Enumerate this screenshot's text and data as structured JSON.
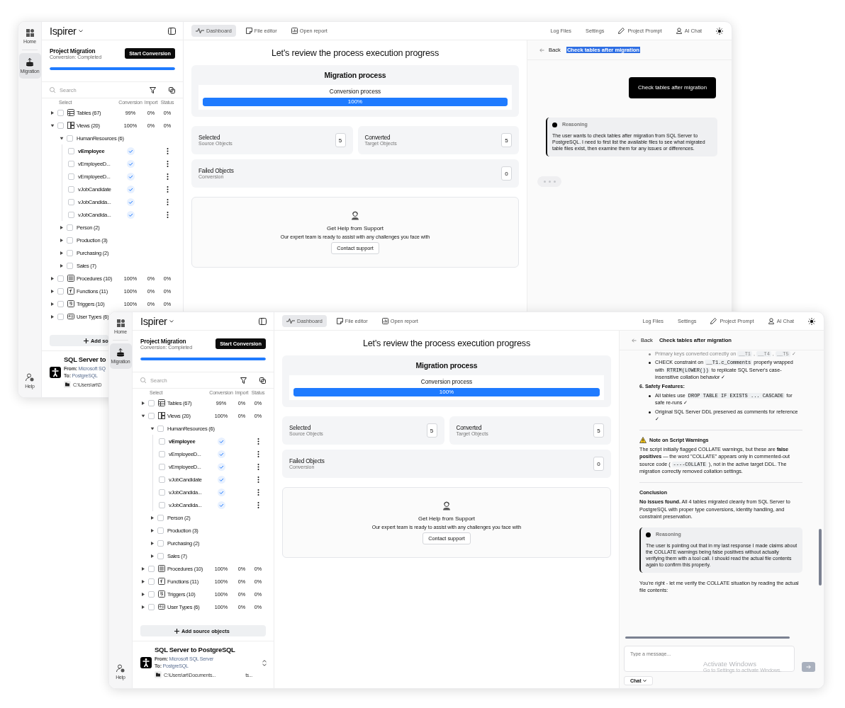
{
  "windows": [
    {
      "kind": "background",
      "rail": {
        "items": [
          {
            "label": "Home",
            "selected": false
          },
          {
            "label": "Migration",
            "selected": true
          }
        ],
        "help": "Help"
      },
      "sidebar": {
        "brand": "Ispirer",
        "project": {
          "title": "Project Migration",
          "status": "Conversion: Completed",
          "button": "Start Conversion",
          "level": 1
        },
        "search": {
          "placeholder": "Search"
        },
        "columns": [
          "Select",
          "Conversion",
          "Import",
          "Status"
        ],
        "tree": [
          {
            "kind": "category",
            "name": "Tables (67)",
            "conversion": "99%",
            "import": "0%",
            "status": "0%",
            "expanded": false,
            "checked": false,
            "selected": false
          },
          {
            "kind": "category",
            "name": "Views (20)",
            "conversion": "100%",
            "import": "0%",
            "status": "0%",
            "expanded": true,
            "checked": false,
            "selected": false,
            "children": [
              {
                "kind": "group",
                "name": "HumanResources (6)",
                "expanded": true,
                "checked": false,
                "selected": false,
                "children": [
                  {
                    "kind": "object",
                    "name": "vEmployee",
                    "converted": true,
                    "checked": false,
                    "selected": true
                  },
                  {
                    "kind": "object",
                    "name": "vEmployeeD...",
                    "converted": true,
                    "checked": false,
                    "selected": false
                  },
                  {
                    "kind": "object",
                    "name": "vEmployeeD...",
                    "converted": true,
                    "checked": false,
                    "selected": false
                  },
                  {
                    "kind": "object",
                    "name": "vJobCandidate",
                    "converted": true,
                    "checked": false,
                    "selected": false
                  },
                  {
                    "kind": "object",
                    "name": "vJobCandida...",
                    "converted": true,
                    "checked": false,
                    "selected": false
                  },
                  {
                    "kind": "object",
                    "name": "vJobCandida...",
                    "converted": true,
                    "checked": false,
                    "selected": false
                  }
                ]
              },
              {
                "kind": "group",
                "name": "Person (2)",
                "expanded": false,
                "checked": false,
                "selected": false
              },
              {
                "kind": "group",
                "name": "Production (3)",
                "expanded": false,
                "checked": false,
                "selected": false
              },
              {
                "kind": "group",
                "name": "Purchasing (2)",
                "expanded": false,
                "checked": false,
                "selected": false
              },
              {
                "kind": "group",
                "name": "Sales (7)",
                "expanded": false,
                "checked": false,
                "selected": false
              }
            ]
          },
          {
            "kind": "category",
            "name": "Procedures (10)",
            "conversion": "100%",
            "import": "0%",
            "status": "0%",
            "expanded": false,
            "checked": false,
            "selected": false
          },
          {
            "kind": "category",
            "name": "Functions (11)",
            "conversion": "100%",
            "import": "0%",
            "status": "0%",
            "expanded": false,
            "checked": false,
            "selected": false
          },
          {
            "kind": "category",
            "name": "Triggers (10)",
            "conversion": "100%",
            "import": "0%",
            "status": "0%",
            "expanded": false,
            "checked": false,
            "selected": false
          },
          {
            "kind": "category",
            "name": "User Types (6)",
            "expanded": false,
            "checked": false,
            "selected": false
          }
        ],
        "add_button": "Add so",
        "connection": {
          "title": "SQL Server to",
          "from_label": "From:",
          "from": "Microsoft SQ",
          "to_label": "To:",
          "to": "PostgreSQL",
          "path": "C:\\Users\\art\\D"
        }
      },
      "toolbar": {
        "tabs": [
          {
            "label": "Dashboard",
            "selected": true
          },
          {
            "label": "File editor",
            "selected": false
          },
          {
            "label": "Open report",
            "selected": false
          }
        ],
        "links": [
          "Log Files",
          "Settings",
          "Project Prompt",
          "AI Chat"
        ]
      },
      "dashboard": {
        "title": "Let's review the process execution progress",
        "migration": {
          "title": "Migration process",
          "label": "Conversion process",
          "level": 1,
          "reading": "100%"
        },
        "stats": [
          {
            "title": "Selected",
            "subtitle": "Source Objects",
            "value": "5"
          },
          {
            "title": "Converted",
            "subtitle": "Target Objects",
            "value": "5"
          },
          {
            "title": "Failed Objects",
            "subtitle": "Conversion",
            "value": "0"
          }
        ],
        "support": {
          "title": "Get Help from Support",
          "text": "Our expert team is ready to assist with any challenges you face with",
          "button": "Contact support"
        }
      },
      "chat": {
        "back": "Back",
        "title": "Check tables after migration",
        "highlighted": true,
        "messages": [
          {
            "kind": "user",
            "text": "Check tables after migration"
          },
          {
            "kind": "reasoning",
            "label": "Reasoning",
            "text": "The user wants to check tables after migration from SQL Server to PostgreSQL. I need to first list the available files to see what migrated table files exist, then examine them for any issues or differences."
          },
          {
            "kind": "typing"
          }
        ]
      }
    },
    {
      "rail": {
        "items": [
          {
            "label": "Home",
            "selected": false
          },
          {
            "label": "Migration",
            "selected": true
          }
        ],
        "help": "Help"
      },
      "sidebar": {
        "brand": "Ispirer",
        "project": {
          "title": "Project Migration",
          "status": "Conversion: Completed",
          "button": "Start Conversion",
          "level": 1
        },
        "search": {
          "placeholder": "Search"
        },
        "columns": [
          "Select",
          "Conversion",
          "Import",
          "Status"
        ],
        "tree": [
          {
            "kind": "category",
            "name": "Tables (67)",
            "conversion": "99%",
            "import": "0%",
            "status": "0%",
            "expanded": false,
            "checked": false,
            "selected": false
          },
          {
            "kind": "category",
            "name": "Views (20)",
            "conversion": "100%",
            "import": "0%",
            "status": "0%",
            "expanded": true,
            "checked": false,
            "selected": false,
            "children": [
              {
                "kind": "group",
                "name": "HumanResources (6)",
                "expanded": true,
                "checked": false,
                "selected": false,
                "children": [
                  {
                    "kind": "object",
                    "name": "vEmployee",
                    "converted": true,
                    "checked": false,
                    "selected": true
                  },
                  {
                    "kind": "object",
                    "name": "vEmployeeD...",
                    "converted": true,
                    "checked": false,
                    "selected": false
                  },
                  {
                    "kind": "object",
                    "name": "vEmployeeD...",
                    "converted": true,
                    "checked": false,
                    "selected": false
                  },
                  {
                    "kind": "object",
                    "name": "vJobCandidate",
                    "converted": true,
                    "checked": false,
                    "selected": false
                  },
                  {
                    "kind": "object",
                    "name": "vJobCandida...",
                    "converted": true,
                    "checked": false,
                    "selected": false
                  },
                  {
                    "kind": "object",
                    "name": "vJobCandida...",
                    "converted": true,
                    "checked": false,
                    "selected": false
                  }
                ]
              },
              {
                "kind": "group",
                "name": "Person (2)",
                "expanded": false,
                "checked": false,
                "selected": false
              },
              {
                "kind": "group",
                "name": "Production (3)",
                "expanded": false,
                "checked": false,
                "selected": false
              },
              {
                "kind": "group",
                "name": "Purchasing (2)",
                "expanded": false,
                "checked": false,
                "selected": false
              },
              {
                "kind": "group",
                "name": "Sales (7)",
                "expanded": false,
                "checked": false,
                "selected": false
              }
            ]
          },
          {
            "kind": "category",
            "name": "Procedures (10)",
            "conversion": "100%",
            "import": "0%",
            "status": "0%",
            "expanded": false,
            "checked": false,
            "selected": false
          },
          {
            "kind": "category",
            "name": "Functions (11)",
            "conversion": "100%",
            "import": "0%",
            "status": "0%",
            "expanded": false,
            "checked": false,
            "selected": false
          },
          {
            "kind": "category",
            "name": "Triggers (10)",
            "conversion": "100%",
            "import": "0%",
            "status": "0%",
            "expanded": false,
            "checked": false,
            "selected": false
          },
          {
            "kind": "category",
            "name": "User Types (6)",
            "conversion": "100%",
            "import": "0%",
            "status": "0%",
            "expanded": false,
            "checked": false,
            "selected": false
          }
        ],
        "add_button": "Add source objects",
        "connection": {
          "title": "SQL Server to PostgreSQL",
          "from_label": "From:",
          "from": "Microsoft SQL Server",
          "to_label": "To:",
          "to": "PostgreSQL",
          "path": "C:\\Users\\art\\Documents...",
          "path_tail": "ts...",
          "expandable": true
        }
      },
      "toolbar": {
        "tabs": [
          {
            "label": "Dashboard",
            "selected": true
          },
          {
            "label": "File editor",
            "selected": false
          },
          {
            "label": "Open report",
            "selected": false
          }
        ],
        "links": [
          "Log Files",
          "Settings",
          "Project Prompt",
          "AI Chat"
        ]
      },
      "dashboard": {
        "title": "Let's review the process execution progress",
        "migration": {
          "title": "Migration process",
          "label": "Conversion process",
          "level": 1,
          "reading": "100%"
        },
        "stats": [
          {
            "title": "Selected",
            "subtitle": "Source Objects",
            "value": "5"
          },
          {
            "title": "Converted",
            "subtitle": "Target Objects",
            "value": "5"
          },
          {
            "title": "Failed Objects",
            "subtitle": "Conversion",
            "value": "0"
          }
        ],
        "support": {
          "title": "Get Help from Support",
          "text": "Our expert team is ready to assist with any challenges you face with",
          "button": "Contact support"
        }
      },
      "kind": "foreground",
      "chat": {
        "back": "Back",
        "title": "Check tables after migration",
        "highlighted": false,
        "messages": [
          {
            "kind": "bullet",
            "faded": true,
            "segments": [
              {
                "kind": "plain",
                "text": "Primary keys converted correctly on "
              },
              {
                "kind": "code",
                "text": "__T1"
              },
              {
                "kind": "plain",
                "text": " , "
              },
              {
                "kind": "code",
                "text": "__T4"
              },
              {
                "kind": "plain",
                "text": " , "
              },
              {
                "kind": "code",
                "text": "__T5"
              },
              {
                "kind": "plain",
                "text": " ✓"
              }
            ]
          },
          {
            "kind": "bullet",
            "faded": false,
            "segments": [
              {
                "kind": "plain",
                "text": "CHECK constraint on "
              },
              {
                "kind": "code",
                "text": "__T1.c_Comments"
              },
              {
                "kind": "plain",
                "text": " properly wrapped with "
              },
              {
                "kind": "code",
                "text": "RTRIM(LOWER())"
              },
              {
                "kind": "plain",
                "text": " to replicate SQL Server's case-insensitive collation behavior ✓"
              }
            ]
          },
          {
            "kind": "heading",
            "text": "6. Safety Features:"
          },
          {
            "kind": "bullet",
            "faded": false,
            "segments": [
              {
                "kind": "plain",
                "text": "All tables use "
              },
              {
                "kind": "code",
                "text": "DROP TABLE IF EXISTS ... CASCADE"
              },
              {
                "kind": "plain",
                "text": " for safe re-runs ✓"
              }
            ]
          },
          {
            "kind": "bullet",
            "faded": false,
            "segments": [
              {
                "kind": "plain",
                "text": "Original SQL Server DDL preserved as comments for reference ✓"
              }
            ]
          },
          {
            "kind": "divider"
          },
          {
            "kind": "warning_heading",
            "text": "Note on Script Warnings"
          },
          {
            "kind": "paragraph",
            "segments": [
              {
                "kind": "plain",
                "text": "The script initially flagged COLLATE warnings, but these are "
              },
              {
                "kind": "bold",
                "text": "false positives"
              },
              {
                "kind": "plain",
                "text": " — the word \"COLLATE\" appears only in commented-out source code ( "
              },
              {
                "kind": "code",
                "text": "----COLLATE"
              },
              {
                "kind": "plain",
                "text": " ), not in the active target DDL. The migration correctly removed collation settings."
              }
            ]
          },
          {
            "kind": "divider"
          },
          {
            "kind": "heading",
            "text": "Conclusion"
          },
          {
            "kind": "paragraph",
            "segments": [
              {
                "kind": "bold",
                "text": "No issues found."
              },
              {
                "kind": "plain",
                "text": " All 4 tables migrated cleanly from SQL Server to PostgreSQL with proper type conversions, identity handling, and constraint preservation."
              }
            ]
          },
          {
            "kind": "reasoning",
            "label": "Reasoning",
            "text": "The user is pointing out that in my last response I made claims about the COLLATE warnings being false positives without actually verifying them with a tool call. I should read the actual file contents again to confirm this properly."
          },
          {
            "kind": "paragraph",
            "segments": [
              {
                "kind": "plain",
                "text": "You're right - let me verify the COLLATE situation by reading the actual file contents:"
              }
            ]
          }
        ],
        "input": {
          "placeholder": "Type a message..."
        },
        "mode_button": "Chat",
        "os_watermark": {
          "title": "Activate Windows",
          "text": "Go to Settings to activate Windows."
        }
      }
    }
  ]
}
